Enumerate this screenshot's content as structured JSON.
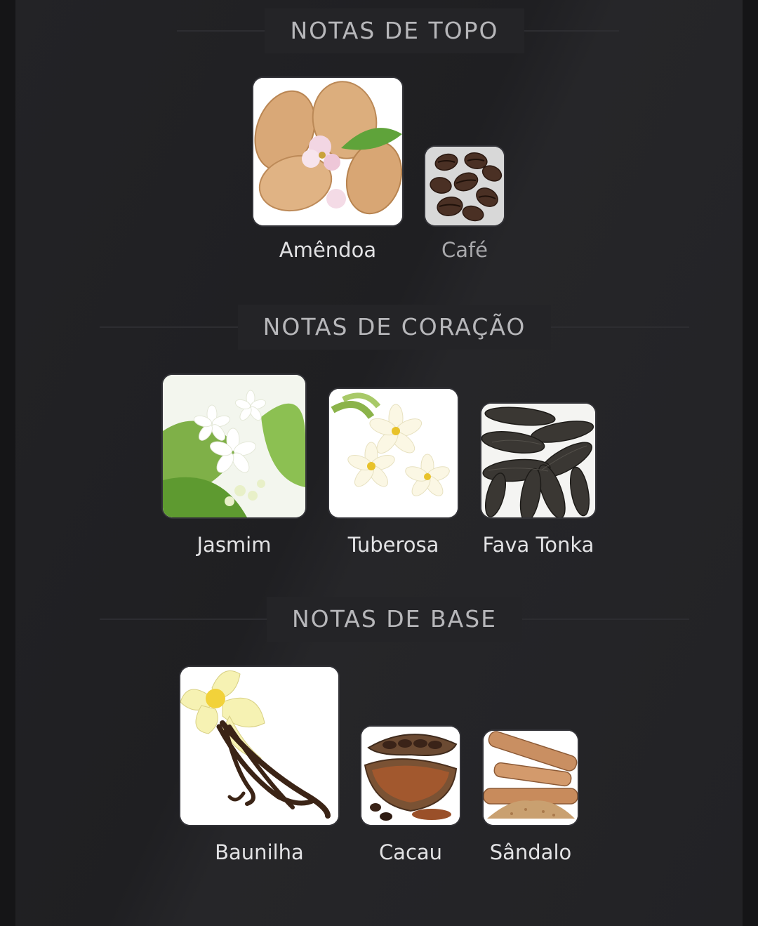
{
  "sections": [
    {
      "title": "NOTAS DE TOPO",
      "notes": [
        {
          "name": "Amêndoa",
          "icon": "almond-icon"
        },
        {
          "name": "Café",
          "icon": "coffee-beans-icon"
        }
      ]
    },
    {
      "title": "NOTAS DE CORAÇÃO",
      "notes": [
        {
          "name": "Jasmim",
          "icon": "jasmine-icon"
        },
        {
          "name": "Tuberosa",
          "icon": "tuberose-icon"
        },
        {
          "name": "Fava Tonka",
          "icon": "tonka-bean-icon"
        }
      ]
    },
    {
      "title": "NOTAS DE BASE",
      "notes": [
        {
          "name": "Baunilha",
          "icon": "vanilla-icon"
        },
        {
          "name": "Cacau",
          "icon": "cacao-icon"
        },
        {
          "name": "Sândalo",
          "icon": "sandalwood-icon"
        }
      ]
    }
  ],
  "colors": {
    "background": "#151517",
    "panel": "#232326",
    "title_text": "#b7b7ba",
    "note_text": "#e2e2e4"
  }
}
